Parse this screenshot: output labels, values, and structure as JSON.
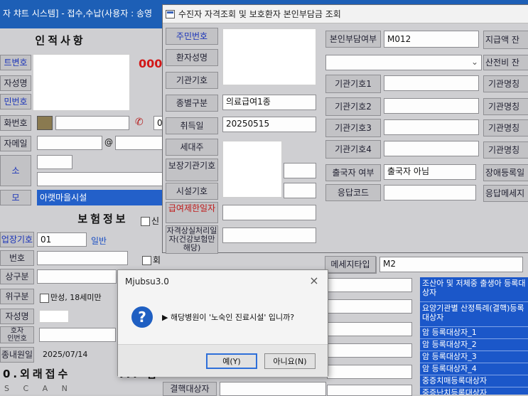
{
  "background_window": {
    "title": "자 챠트 시스템] - 접수,수납(사용자 : 송영",
    "patient_info_header": "인적사항",
    "red_code": "000",
    "labels": {
      "reg_no": "트변호",
      "name": "자성명",
      "resident_no": "민번호",
      "phone": "화번호",
      "email": "자메일",
      "address": "소",
      "mo": "모",
      "insurance_header": "보험정보",
      "workplace_code": "업장기호",
      "number": "번호",
      "category": "상구분",
      "priority": "위구분",
      "insured_name": "자성명",
      "relation_no": "호자\n인번호",
      "visit_date": "종내원일",
      "external": "0.외래접수",
      "scan": "S C A N"
    },
    "values": {
      "email_at": "@",
      "mo_value": "아랫마을시설",
      "workplace_value": "01",
      "general": "일반",
      "age_check": "만성, 18세미만",
      "visit_date": "2025/07/14",
      "check_label": "신",
      "check_label2": "회",
      "partial_ii": "II. 입",
      "phone_partial": "0"
    }
  },
  "qualification_window": {
    "title": "수진자 자격조회 및 보호환자 본인부담금 조회",
    "left_labels": [
      "주민번호",
      "환자성명",
      "기관기호",
      "종별구분",
      "취득일",
      "세대주",
      "보장기관기호",
      "시설기호",
      "급여제한일자",
      "자격상실처리일자(건강보험만해당)"
    ],
    "type_value": "의료급여1종",
    "acquire_date": "20250515",
    "copay_label": "본인부담여부",
    "copay_value": "M012",
    "right_labels": [
      "기관기호1",
      "기관기호2",
      "기관기호3",
      "기관기호4"
    ],
    "emigrant_label": "출국자 여부",
    "emigrant_value": "출국자 아님",
    "response_code_label": "응답코드",
    "message_type_label": "메세지타입",
    "message_type_value": "M2",
    "bottom_label": "결핵대상자",
    "far_right_labels": [
      "지급액 잔",
      "산전비 잔",
      "기관명칭",
      "기관명칭",
      "기관명칭",
      "기관명칭",
      "장애등록일",
      "응답메세지"
    ],
    "target_list": [
      "조산아 및 저체중 출생아 등록대상자",
      "요양기관별 산정특례(결핵)등록대상자",
      "암 등록대상자_1",
      "암 등록대상자_2",
      "암 등록대상자_3",
      "암 등록대상자_4",
      "중증치매등록대상자",
      "중증난치등록대상자"
    ]
  },
  "message_box": {
    "title": "Mjubsu3.0",
    "close": "×",
    "icon": "question-icon",
    "text": "▶ 해당병원이 '노숙인 진료시설' 입니까?",
    "yes_label": "예(Y)",
    "no_label": "아니요(N)"
  }
}
